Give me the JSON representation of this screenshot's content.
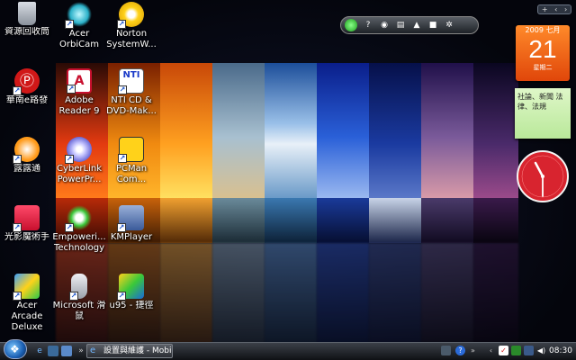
{
  "desktop_icons": [
    {
      "label": "資源回收筒",
      "icon": "recycle-bin-icon"
    },
    {
      "label": "Acer OrbiCam",
      "icon": "webcam-icon"
    },
    {
      "label": "Norton SystemW...",
      "icon": "norton-icon"
    },
    {
      "label": "華南e路發",
      "icon": "bank-app-icon"
    },
    {
      "label": "Adobe Reader 9",
      "icon": "pdf-reader-icon"
    },
    {
      "label": "NTI CD & DVD-Mak...",
      "icon": "disc-maker-icon"
    },
    {
      "label": "露露通",
      "icon": "chat-app-icon"
    },
    {
      "label": "CyberLink PowerPr...",
      "icon": "media-disc-icon"
    },
    {
      "label": "PCMan Com...",
      "icon": "pcman-icon"
    },
    {
      "label": "光影魔術手",
      "icon": "photo-editor-icon"
    },
    {
      "label": "Empoweri... Technology",
      "icon": "empowering-icon"
    },
    {
      "label": "KMPlayer",
      "icon": "kmplayer-icon"
    },
    {
      "label": "Acer Arcade Deluxe",
      "icon": "arcade-icon"
    },
    {
      "label": "Microsoft 滑鼠",
      "icon": "mouse-icon"
    },
    {
      "label": "u95 - 捷徑",
      "icon": "shortcut-app-icon"
    }
  ],
  "gadgets": {
    "toolbar_buttons": [
      "power-icon",
      "help-icon",
      "rss-icon",
      "network-icon",
      "wifi-icon",
      "lock-icon",
      "settings-icon"
    ],
    "sidebar_controls": [
      "+",
      "‹",
      "›"
    ],
    "calendar": {
      "year_month": "2009 七月",
      "day": "21",
      "weekday": "星期二"
    },
    "note_text": "社論、新聞 法律、法規"
  },
  "taskbar": {
    "task_label": "設置與維護 - Mobile...",
    "clock": "08:30"
  },
  "colors": {
    "accent": "#e0460a",
    "note": "#c8efaa",
    "clock_face": "#d8242f"
  }
}
